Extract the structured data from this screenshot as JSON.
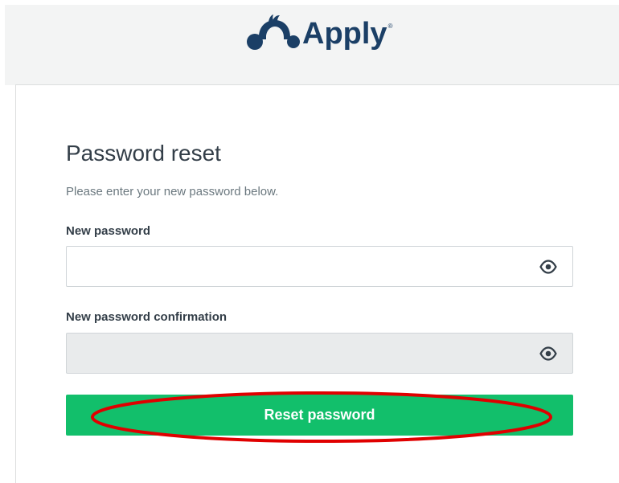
{
  "brand": {
    "name": "Apply",
    "registered_mark": "®",
    "color": "#1b3f66"
  },
  "form": {
    "title": "Password reset",
    "subtitle": "Please enter your new password below.",
    "new_password": {
      "label": "New password",
      "value": "",
      "placeholder": "",
      "toggle_icon": "eye-icon"
    },
    "confirm_password": {
      "label": "New password confirmation",
      "value": "",
      "placeholder": "",
      "toggle_icon": "eye-icon"
    },
    "submit_label": "Reset password",
    "submit_color": "#12bf6b"
  },
  "annotation": {
    "type": "ellipse",
    "color": "#e00000",
    "target": "submit-button"
  }
}
